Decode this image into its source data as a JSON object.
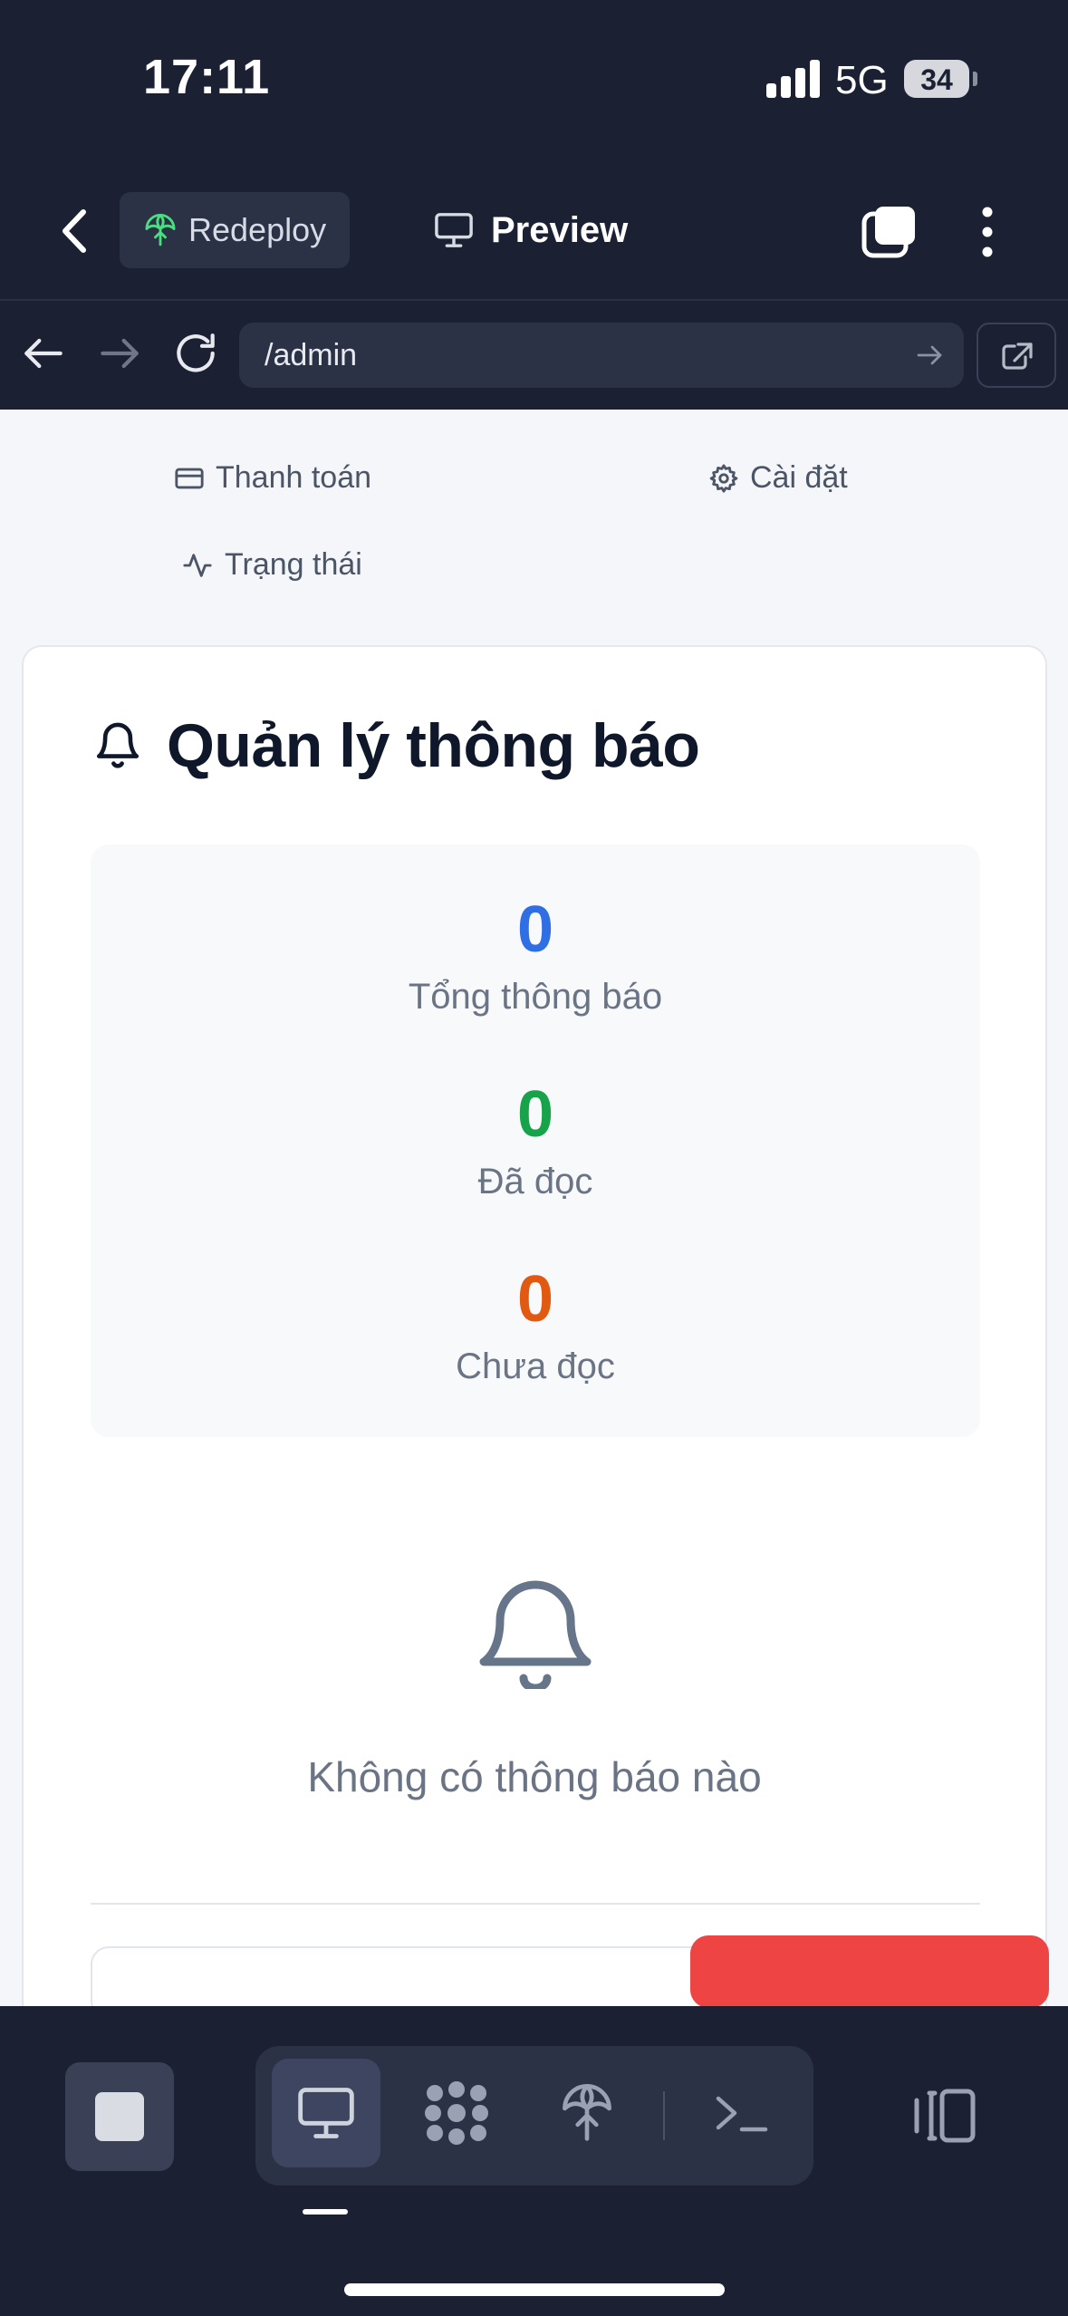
{
  "status_bar": {
    "time": "17:11",
    "network": "5G",
    "battery": "34"
  },
  "toolbar": {
    "redeploy_label": "Redeploy",
    "preview_label": "Preview"
  },
  "url_bar": {
    "url": "/admin"
  },
  "page": {
    "nav_links": [
      {
        "label": "Thanh toán",
        "icon": "credit-card-icon"
      },
      {
        "label": "Cài đặt",
        "icon": "gear-icon"
      },
      {
        "label": "Trạng thái",
        "icon": "activity-icon"
      }
    ],
    "card": {
      "title": "Quản lý thông báo",
      "stats": [
        {
          "value": "0",
          "label": "Tổng thông báo",
          "color": "#2f6ee5"
        },
        {
          "value": "0",
          "label": "Đã đọc",
          "color": "#16a34a"
        },
        {
          "value": "0",
          "label": "Chưa đọc",
          "color": "#e25a12"
        }
      ],
      "empty_message": "Không có thông báo nào"
    }
  },
  "colors": {
    "app_bg": "#1b2033",
    "surface": "#2b3246",
    "accent_green": "#4ade80",
    "danger": "#ef4444"
  },
  "dock": {
    "items": [
      "stop-icon",
      "monitor-icon",
      "grid-dots-icon",
      "deploy-icon",
      "terminal-icon",
      "split-view-icon"
    ]
  }
}
